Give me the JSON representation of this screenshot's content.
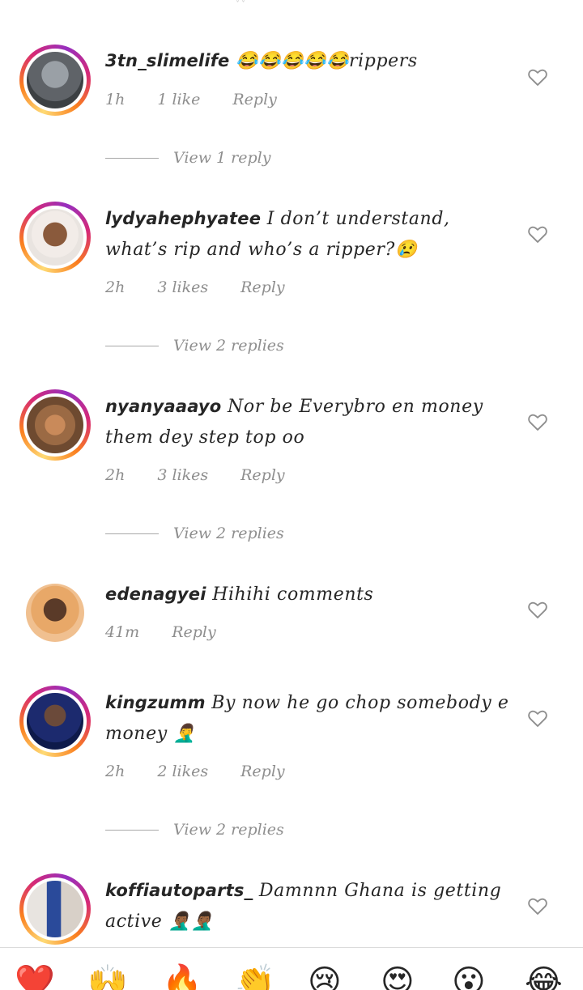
{
  "comments": [
    {
      "username": "3tn_slimelife",
      "text": " 😂😂😂😂😂rippers",
      "time": "1h",
      "likes": "1 like",
      "reply": "Reply",
      "view_replies": "View 1 reply",
      "story_ring": true
    },
    {
      "username": "lydyahephyatee",
      "text": " I don’t understand, what’s rip and who’s a ripper?😢",
      "time": "2h",
      "likes": "3 likes",
      "reply": "Reply",
      "view_replies": "View 2 replies",
      "story_ring": true
    },
    {
      "username": "nyanyaaayo",
      "text": " Nor be Everybro en money them dey step top oo",
      "time": "2h",
      "likes": "3 likes",
      "reply": "Reply",
      "view_replies": "View 2 replies",
      "story_ring": true
    },
    {
      "username": "edenagyei",
      "text": " Hihihi comments",
      "time": "41m",
      "reply": "Reply",
      "story_ring": false
    },
    {
      "username": "kingzumm",
      "text": " By now he go chop somebody e money 🤦‍♂️",
      "time": "2h",
      "likes": "2 likes",
      "reply": "Reply",
      "view_replies": "View 2 replies",
      "story_ring": true
    },
    {
      "username": "koffiautoparts_",
      "text": " Damnnn Ghana is getting active 🤦🏾‍♂️🤦🏾‍♂️",
      "story_ring": true
    }
  ],
  "emoji_bar": [
    "❤️",
    "🙌",
    "🔥",
    "👏",
    "😢",
    "😍",
    "😮",
    "😂"
  ],
  "colors": {
    "meta_text": "#8e8e8e",
    "text": "#262626",
    "ring_start": "#feda75",
    "ring_end": "#962fbf"
  }
}
